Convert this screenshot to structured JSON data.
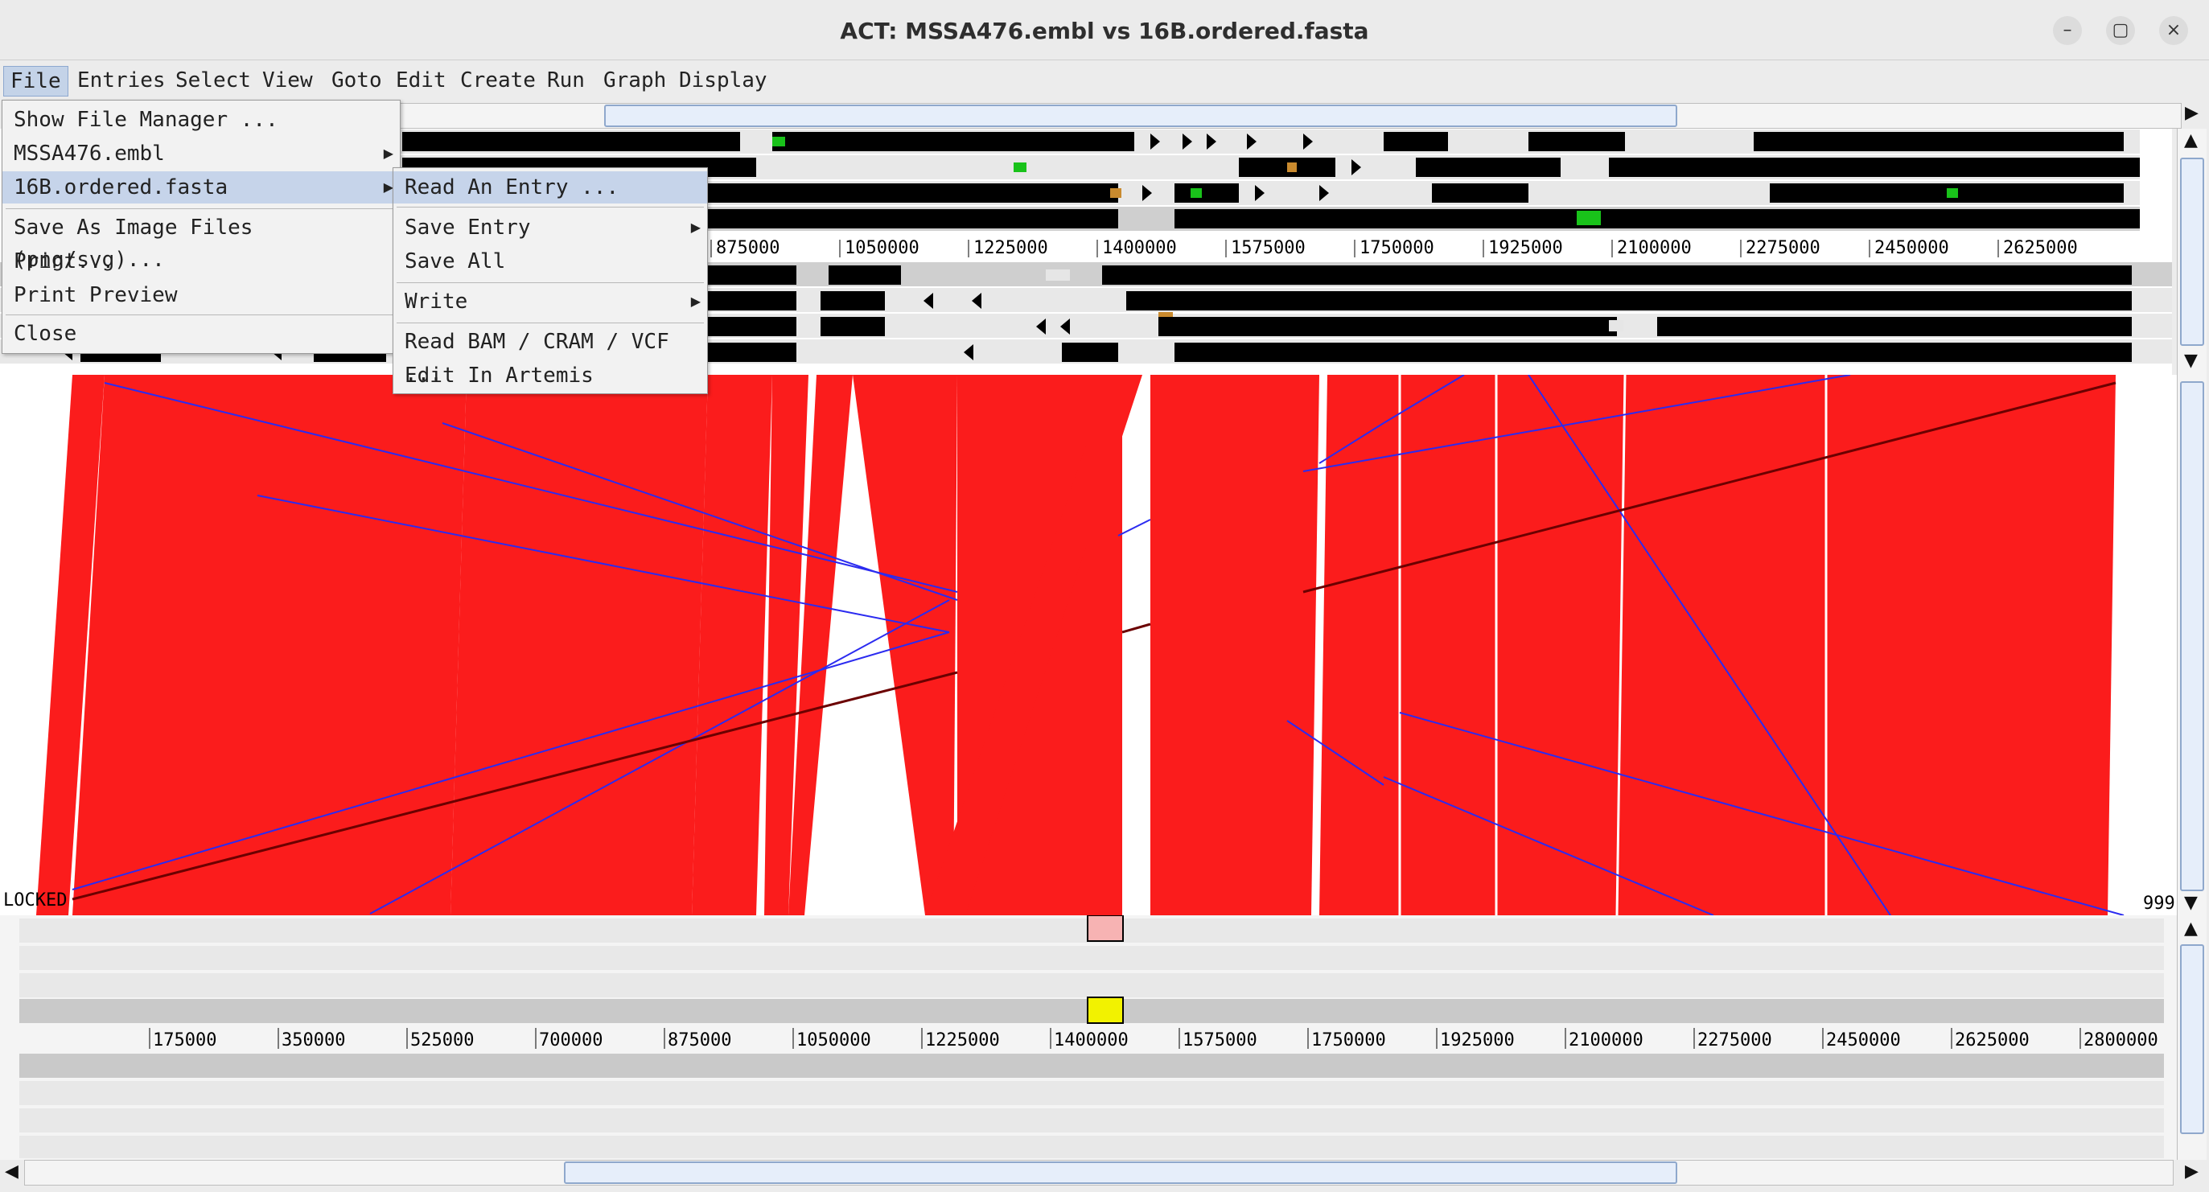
{
  "window": {
    "title": "ACT: MSSA476.embl vs 16B.ordered.fasta",
    "minimize_glyph": "–",
    "maximize_glyph": "▢",
    "close_glyph": "×"
  },
  "menubar": [
    "File",
    "Entries",
    "Select",
    "View",
    "Goto",
    "Edit",
    "Create",
    "Run",
    "Graph",
    "Display"
  ],
  "file_menu": {
    "items": [
      "Show File Manager ...",
      "MSSA476.embl",
      "16B.ordered.fasta",
      "Save As Image Files (png/svg)...",
      "Print...",
      "Print Preview",
      "Close"
    ]
  },
  "submenu": {
    "items": [
      "Read An Entry ...",
      "Save Entry",
      "Save All",
      "Write",
      "Read BAM / CRAM / VCF ...",
      "Edit In Artemis"
    ]
  },
  "top_ruler": [
    "875000",
    "1050000",
    "1225000",
    "1400000",
    "1575000",
    "1750000",
    "1925000",
    "2100000",
    "2275000",
    "2450000",
    "2625000"
  ],
  "bottom_ruler": [
    "175000",
    "350000",
    "525000",
    "700000",
    "875000",
    "1050000",
    "1225000",
    "1400000",
    "1575000",
    "1750000",
    "1925000",
    "2100000",
    "2275000",
    "2450000",
    "2625000",
    "2800000"
  ],
  "comparison": {
    "locked_label": "LOCKED",
    "score_label": "999"
  },
  "colors": {
    "match": "#fb1c1c",
    "inversion": "#2b2bf0",
    "selection": "#f2f200",
    "marker": "#f7b3b3"
  }
}
